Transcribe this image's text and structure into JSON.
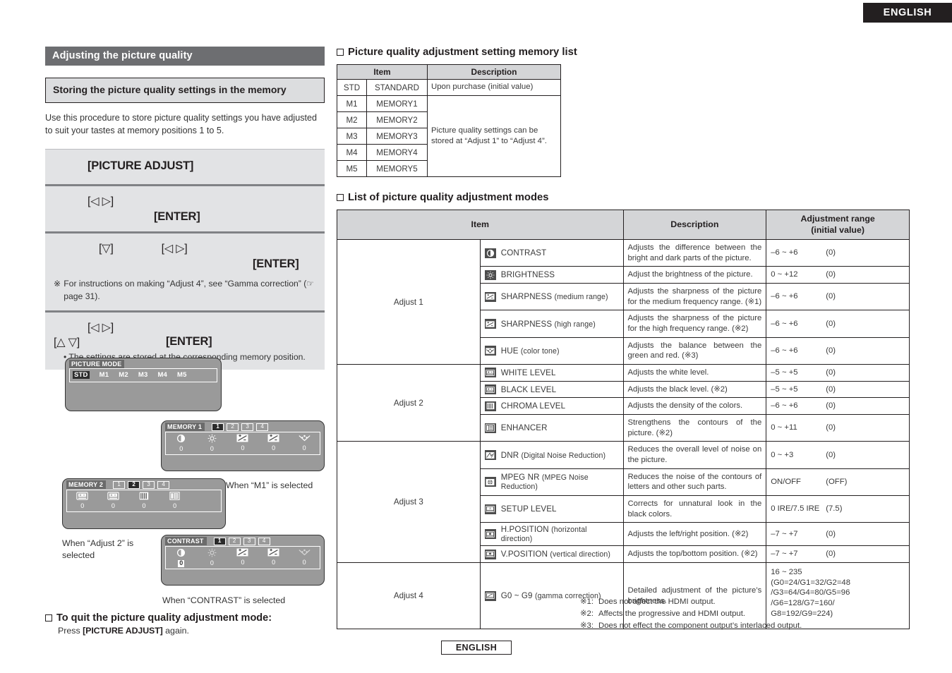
{
  "language_tab": "ENGLISH",
  "language_footer": "ENGLISH",
  "left": {
    "section_title": "Adjusting the picture quality",
    "sub_title": "Storing the picture quality settings in the memory",
    "intro": "Use this procedure to store picture quality settings you have adjusted to suit your tastes at memory positions 1 to 5.",
    "steps": {
      "step1_key": "[PICTURE ADJUST]",
      "step2_key_a": "[◁ ▷]",
      "step2_key_b": "[ENTER]",
      "step3_key_a": "[▽]",
      "step3_key_b": "[◁  ▷]",
      "step3_key_c": "[ENTER]",
      "step3_note_mark": "※",
      "step3_note": "For instructions on making “Adjust 4”, see “Gamma correction” (☞ page 31).",
      "step4_key_a": "[◁ ▷]",
      "step4_key_b": "[△ ▽]",
      "step4_key_c": "[ENTER]",
      "step4_note": "• The settings are stored at the corresponding memory position."
    },
    "osd": {
      "picture_mode": {
        "title": "PICTURE MODE",
        "items": [
          "STD",
          "M1",
          "M2",
          "M3",
          "M4",
          "M5"
        ],
        "selected": "STD"
      },
      "memory1": {
        "title": "MEMORY 1",
        "tabs": [
          "1",
          "2",
          "3",
          "4"
        ],
        "selected_tab": "1",
        "icons": [
          "contrast-icon",
          "brightness-icon",
          "sharpness-icon",
          "sharpness-icon",
          "hue-icon"
        ],
        "values": [
          "0",
          "0",
          "0",
          "0",
          "0"
        ],
        "highlighted_value_index": -1
      },
      "memory2": {
        "title": "MEMORY 2",
        "tabs": [
          "1",
          "2",
          "3",
          "4"
        ],
        "selected_tab": "2",
        "icons": [
          "white-level-icon",
          "black-level-icon",
          "chroma-level-icon",
          "enhancer-icon"
        ],
        "values": [
          "0",
          "0",
          "0",
          "0"
        ],
        "highlighted_value_index": -1
      },
      "contrast": {
        "title": "CONTRAST",
        "tabs": [
          "1",
          "2",
          "3",
          "4"
        ],
        "selected_tab": "1",
        "icons": [
          "contrast-icon",
          "brightness-icon",
          "sharpness-icon",
          "sharpness-icon",
          "hue-icon"
        ],
        "values": [
          "0",
          "0",
          "0",
          "0",
          "0"
        ],
        "highlighted_value_index": 0
      },
      "captions": {
        "m1": "When “M1” is selected",
        "adjust2": "When “Adjust 2” is selected",
        "contrast": "When “CONTRAST” is selected"
      }
    },
    "quit": {
      "heading": "To quit the picture quality adjustment mode:",
      "body_pre": "Press ",
      "body_key": "[PICTURE ADJUST]",
      "body_post": " again."
    }
  },
  "right": {
    "memory_list": {
      "heading": "Picture quality adjustment setting memory list",
      "headers": {
        "item": "Item",
        "description": "Description"
      },
      "rows": [
        {
          "code": "STD",
          "name": "STANDARD",
          "desc": "Upon purchase (initial value)"
        },
        {
          "code": "M1",
          "name": "MEMORY1"
        },
        {
          "code": "M2",
          "name": "MEMORY2"
        },
        {
          "code": "M3",
          "name": "MEMORY3"
        },
        {
          "code": "M4",
          "name": "MEMORY4"
        },
        {
          "code": "M5",
          "name": "MEMORY5"
        }
      ],
      "merged_desc": "Picture quality settings can be stored at “Adjust 1” to “Adjust 4”."
    },
    "modes_list": {
      "heading": "List of picture quality adjustment modes",
      "headers": {
        "item": "Item",
        "description": "Description",
        "range_l1": "Adjustment range",
        "range_l2": "(initial value)"
      },
      "groups": [
        {
          "name": "Adjust 1",
          "rows": [
            {
              "icon": "contrast-icon",
              "label": "CONTRAST",
              "sub": "",
              "desc": "Adjusts the difference between the bright and dark parts of the picture.",
              "range": "–6 ~ +6",
              "init": "(0)"
            },
            {
              "icon": "brightness-icon",
              "label": "BRIGHTNESS",
              "sub": "",
              "desc": "Adjust the brightness of the picture.",
              "range": "0 ~ +12",
              "init": "(0)"
            },
            {
              "icon": "sharpness-icon",
              "label": "SHARPNESS",
              "sub": "(medium range)",
              "desc": "Adjusts the sharpness of the picture for the medium frequency range. (※1)",
              "range": "–6 ~ +6",
              "init": "(0)"
            },
            {
              "icon": "sharpness-icon",
              "label": "SHARPNESS",
              "sub": "(high range)",
              "desc": "Adjusts the sharpness of the picture for the high frequency range. (※2)",
              "range": "–6 ~ +6",
              "init": "(0)"
            },
            {
              "icon": "hue-icon",
              "label": "HUE",
              "sub": "(color tone)",
              "desc": "Adjusts the balance between the green and red. (※3)",
              "range": "–6 ~ +6",
              "init": "(0)"
            }
          ]
        },
        {
          "name": "Adjust 2",
          "rows": [
            {
              "icon": "white-level-icon",
              "label": "WHITE LEVEL",
              "sub": "",
              "desc": "Adjusts the white level.",
              "range": "–5 ~ +5",
              "init": "(0)"
            },
            {
              "icon": "black-level-icon",
              "label": "BLACK LEVEL",
              "sub": "",
              "desc": "Adjusts the black level. (※2)",
              "range": "–5 ~ +5",
              "init": "(0)"
            },
            {
              "icon": "chroma-level-icon",
              "label": "CHROMA LEVEL",
              "sub": "",
              "desc": "Adjusts the density of the colors.",
              "range": "–6 ~ +6",
              "init": "(0)"
            },
            {
              "icon": "enhancer-icon",
              "label": "ENHANCER",
              "sub": "",
              "desc": "Strengthens the contours of the picture. (※2)",
              "range": "0 ~ +11",
              "init": "(0)"
            }
          ]
        },
        {
          "name": "Adjust 3",
          "rows": [
            {
              "icon": "dnr-icon",
              "label": "DNR",
              "sub": "(Digital Noise Reduction)",
              "desc": "Reduces the overall level of noise on the picture.",
              "range": "0 ~ +3",
              "init": "(0)"
            },
            {
              "icon": "mpeg-nr-icon",
              "label": "MPEG NR",
              "sub": "(MPEG Noise Reduction)",
              "desc": "Reduces the noise of the contours of letters and other such parts.",
              "range": "ON/OFF",
              "init": "(OFF)"
            },
            {
              "icon": "setup-level-icon",
              "label": "SETUP LEVEL",
              "sub": "",
              "desc": "Corrects for unnatural look in the black colors.",
              "range": "0 IRE/7.5 IRE",
              "init": "(7.5)"
            },
            {
              "icon": "h-position-icon",
              "label": "H.POSITION",
              "sub": "(horizontal direction)",
              "desc": "Adjusts the left/right position. (※2)",
              "range": "–7 ~ +7",
              "init": "(0)"
            },
            {
              "icon": "v-position-icon",
              "label": "V.POSITION",
              "sub": "(vertical direction)",
              "desc": "Adjusts the top/bottom position. (※2)",
              "range": "–7 ~ +7",
              "init": "(0)"
            }
          ]
        },
        {
          "name": "Adjust 4",
          "rows": [
            {
              "icon": "gamma-icon",
              "label": "G0 ~ G9",
              "sub": "(gamma correction)",
              "desc": "Detailed adjustment of the picture’s brightness.",
              "range": "16 ~ 235\n(G0=24/G1=32/G2=48\n/G3=64/G4=80/G5=96\n/G6=128/G7=160/\nG8=192/G9=224)",
              "init": ""
            }
          ]
        }
      ]
    },
    "footnotes": [
      {
        "mark": "※1:",
        "text": "Does not affect the HDMI output."
      },
      {
        "mark": "※2:",
        "text": "Affects the progressive and HDMI output."
      },
      {
        "mark": "※3:",
        "text": "Does not effect the component output’s interlaced output."
      }
    ]
  }
}
